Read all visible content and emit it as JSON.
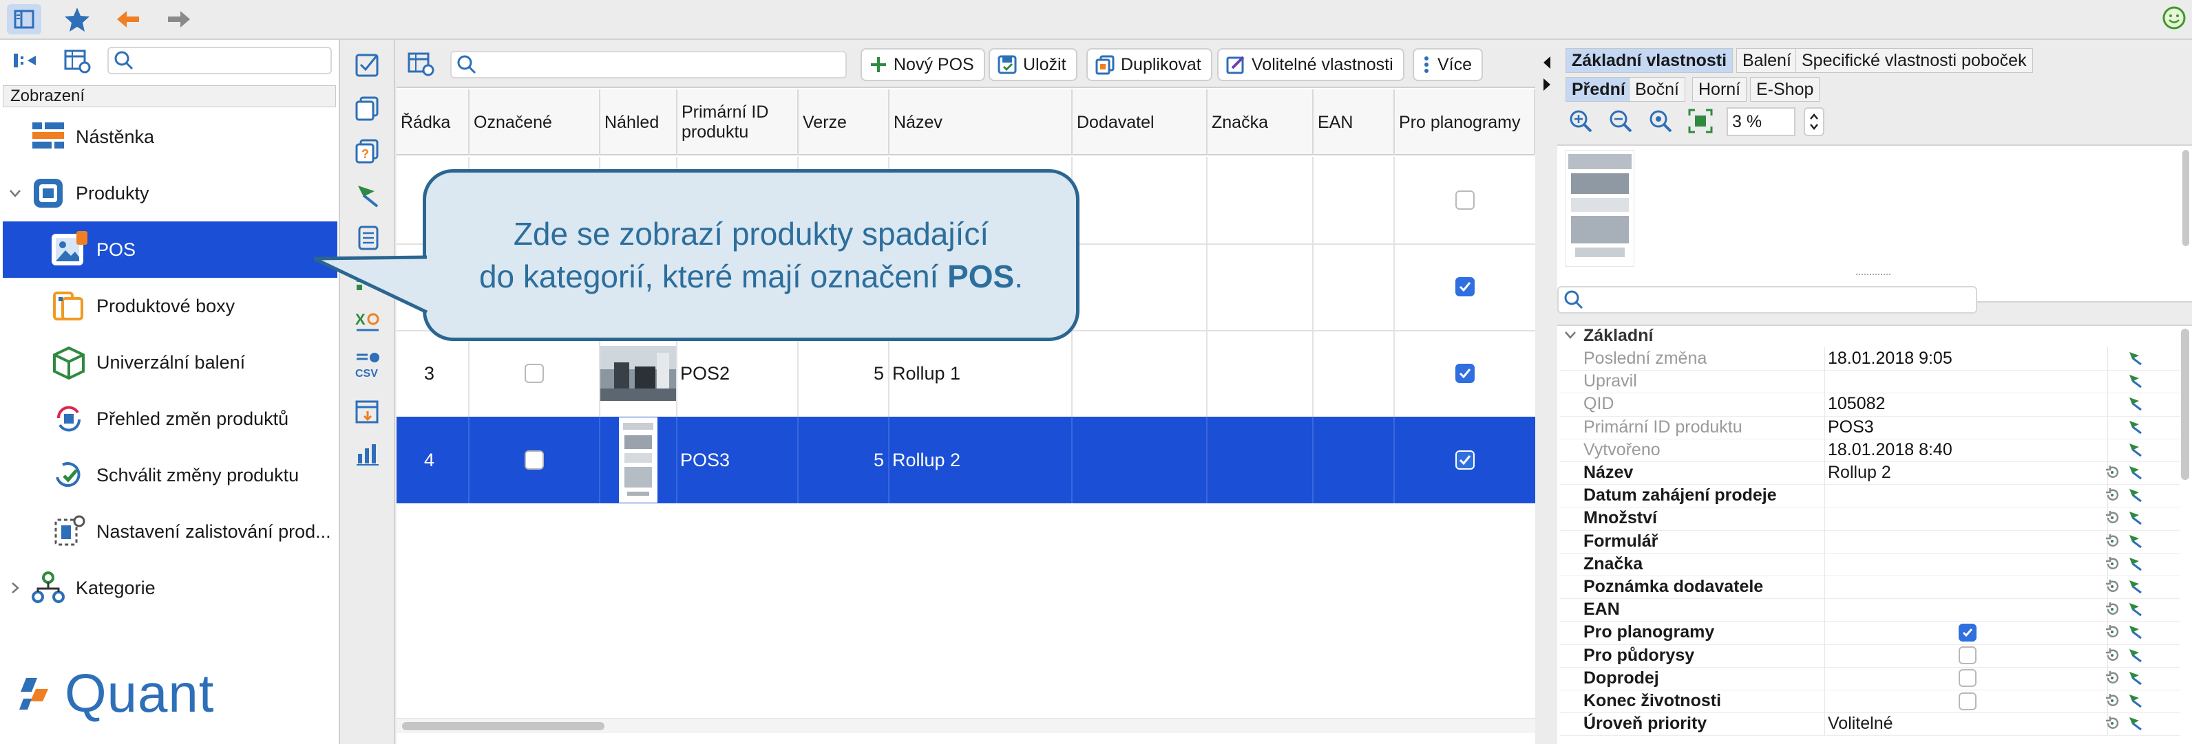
{
  "toolbar": {
    "icons": [
      "sidebar-toggle-icon",
      "star-icon",
      "back-arrow-icon",
      "forward-arrow-icon"
    ],
    "status_icon": "smiley-status-icon"
  },
  "sidebar": {
    "section_label": "Zobrazení",
    "items": [
      {
        "label": "Nástěnka",
        "icon": "dashboard-icon",
        "level": 0
      },
      {
        "label": "Produkty",
        "icon": "products-icon",
        "level": 0,
        "expanded": true
      },
      {
        "label": "POS",
        "icon": "pos-image-icon",
        "level": 1,
        "selected": true
      },
      {
        "label": "Produktové boxy",
        "icon": "product-boxes-icon",
        "level": 1
      },
      {
        "label": "Univerzální balení",
        "icon": "package-icon",
        "level": 1
      },
      {
        "label": "Přehled změn produktů",
        "icon": "changes-overview-icon",
        "level": 1
      },
      {
        "label": "Schválit změny produktu",
        "icon": "approve-changes-icon",
        "level": 1
      },
      {
        "label": "Nastavení zalistování prod...",
        "icon": "listing-settings-icon",
        "level": 1
      },
      {
        "label": "Kategorie",
        "icon": "categories-icon",
        "level": 0
      }
    ],
    "logo_text": "Quant"
  },
  "center_toolbar": {
    "search_placeholder": "",
    "buttons": [
      {
        "label": "Nový POS",
        "icon": "plus-icon"
      },
      {
        "label": "Uložit",
        "icon": "save-icon"
      },
      {
        "label": "Duplikovat",
        "icon": "duplicate-icon"
      },
      {
        "label": "Volitelné vlastnosti",
        "icon": "optional-properties-icon"
      },
      {
        "label": "Více",
        "icon": "more-vertical-icon"
      }
    ]
  },
  "grid": {
    "columns": [
      "Řádka",
      "Označené",
      "Náhled",
      "Primární ID produktu",
      "Verze",
      "Název",
      "Dodavatel",
      "Značka",
      "EAN",
      "Pro planogramy"
    ],
    "rows": [
      {
        "row": "",
        "marked": false,
        "id": "",
        "version": "",
        "name": "",
        "planogram": false,
        "show_marked": false,
        "selected": false
      },
      {
        "row": "",
        "marked": false,
        "id": "",
        "version": "",
        "name": "",
        "planogram": true,
        "show_marked": false,
        "selected": false
      },
      {
        "row": "3",
        "marked": false,
        "id": "POS2",
        "version": "5",
        "name": "Rollup 1",
        "planogram": true,
        "show_marked": true,
        "selected": false
      },
      {
        "row": "4",
        "marked": false,
        "id": "POS3",
        "version": "5",
        "name": "Rollup 2",
        "planogram": true,
        "show_marked": true,
        "selected": true
      }
    ]
  },
  "callout": {
    "line1": "Zde se zobrazí produkty spadající",
    "line2_prefix": "do kategorií, které mají označení ",
    "line2_bold": "POS",
    "line2_suffix": "."
  },
  "right_panel": {
    "tabs": [
      "Základní vlastnosti",
      "Balení",
      "Specifické vlastnosti poboček"
    ],
    "view_tabs": [
      "Přední",
      "Boční",
      "Horní",
      "E-Shop"
    ],
    "zoom_value": "3 %",
    "zoom_icons": [
      "zoom-in-icon",
      "zoom-out-icon",
      "zoom-reset-icon",
      "fit-icon"
    ],
    "search_placeholder": "",
    "group_label": "Základní",
    "properties": [
      {
        "name": "Poslední změna",
        "value": "18.01.2018 9:05",
        "editable": false
      },
      {
        "name": "Upravil",
        "value": "",
        "editable": false
      },
      {
        "name": "QID",
        "value": "105082",
        "editable": false
      },
      {
        "name": "Primární ID produktu",
        "value": "POS3",
        "editable": false
      },
      {
        "name": "Vytvořeno",
        "value": "18.01.2018 8:40",
        "editable": false
      },
      {
        "name": "Název",
        "value": "Rollup 2",
        "editable": true
      },
      {
        "name": "Datum zahájení prodeje",
        "value": "",
        "editable": true
      },
      {
        "name": "Množství",
        "value": "",
        "editable": true
      },
      {
        "name": "Formulář",
        "value": "",
        "editable": true
      },
      {
        "name": "Značka",
        "value": "",
        "editable": true
      },
      {
        "name": "Poznámka dodavatele",
        "value": "",
        "editable": true
      },
      {
        "name": "EAN",
        "value": "",
        "editable": true
      },
      {
        "name": "Pro planogramy",
        "value": "",
        "checkbox": true,
        "checked": true,
        "editable": true
      },
      {
        "name": "Pro půdorysy",
        "value": "",
        "checkbox": true,
        "checked": false,
        "editable": true
      },
      {
        "name": "Doprodej",
        "value": "",
        "checkbox": true,
        "checked": false,
        "editable": true
      },
      {
        "name": "Konec životnosti",
        "value": "",
        "checkbox": true,
        "checked": false,
        "editable": true
      },
      {
        "name": "Úroveň priority",
        "value": "Volitelné",
        "editable": true
      }
    ]
  },
  "colors": {
    "selection": "#1b4fd6",
    "accent": "#2f6fe0",
    "callout_border": "#2b6691",
    "callout_fill": "#dbe7f1",
    "logo": "#2d6fb8"
  }
}
